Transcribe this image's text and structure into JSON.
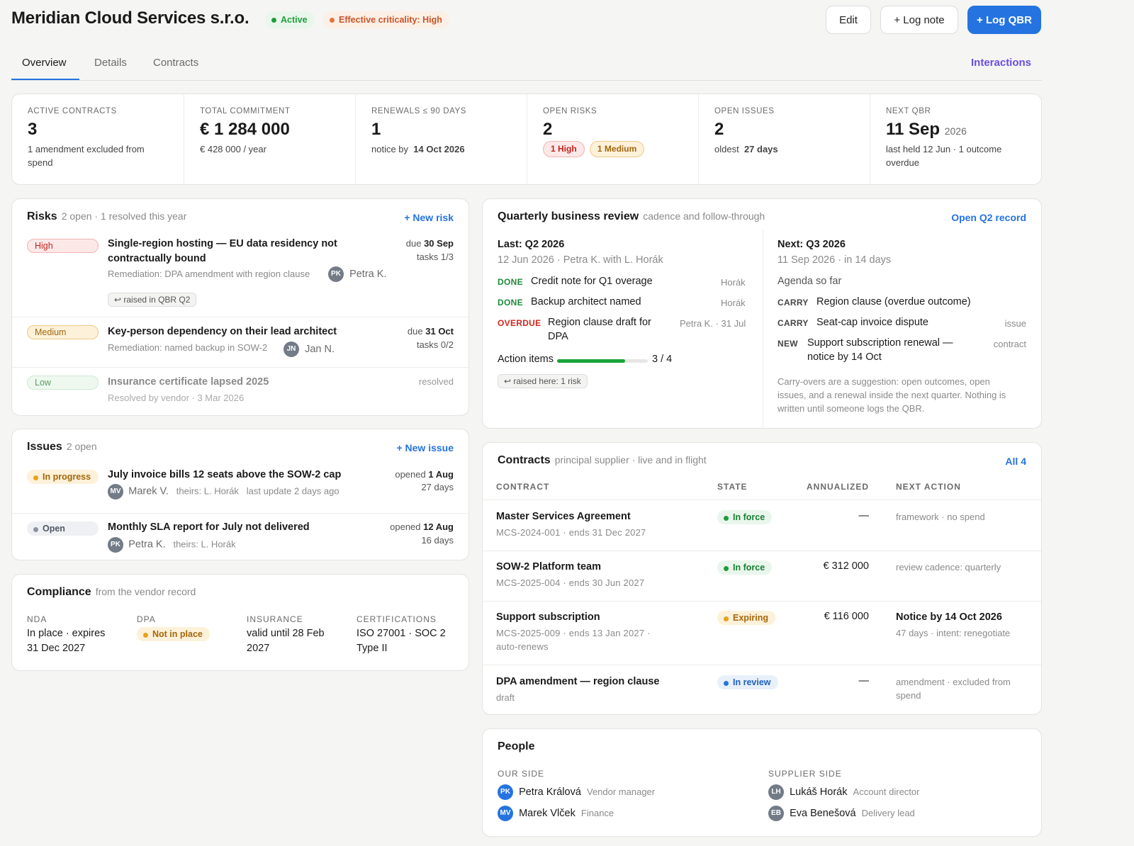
{
  "header": {
    "title": "Meridian Cloud Services s.r.o.",
    "status": "Active",
    "criticality": "Effective criticality: High",
    "edit": "Edit",
    "log_note": "+ Log note",
    "log_qbr": "+ Log QBR",
    "colors": {
      "active": "#1f9d3a",
      "criticality": "#e0763d",
      "primary": "#2573e0"
    }
  },
  "tabs": {
    "overview": "Overview",
    "details": "Details",
    "contracts": "Contracts",
    "interactions": "Interactions"
  },
  "kpis": [
    {
      "label": "ACTIVE CONTRACTS",
      "value": "3",
      "sub": "1 amendment excluded from spend"
    },
    {
      "label": "TOTAL COMMITMENT",
      "value": "€ 1 284 000",
      "sub": "€ 428 000 / year"
    },
    {
      "label": "RENEWALS ≤ 90 DAYS",
      "value": "1",
      "sub_prefix": "notice by",
      "sub_bold": "14 Oct 2026"
    },
    {
      "label": "OPEN RISKS",
      "value": "2",
      "pill_high": "1 High",
      "pill_med": "1 Medium"
    },
    {
      "label": "OPEN ISSUES",
      "value": "2",
      "sub_prefix": "oldest",
      "sub_bold": "27 days"
    },
    {
      "label": "NEXT QBR",
      "value": "11 Sep",
      "value_small": "2026",
      "sub": "last held 12 Jun · 1 outcome overdue"
    }
  ],
  "risks": {
    "title": "Risks",
    "subtitle": "2 open · 1 resolved this year",
    "new": "+ New risk",
    "items": [
      {
        "level": "High",
        "title_l1": "Single-region hosting — EU data residency not",
        "title_l2": "contractually bound",
        "remediation": "Remediation: DPA amendment with region clause",
        "owner_initials": "PK",
        "owner": "Petra K.",
        "due_prefix": "due",
        "due": "30 Sep",
        "tasks": "tasks 1/3",
        "chip": "↩ raised in QBR Q2"
      },
      {
        "level": "Medium",
        "title": "Key-person dependency on their lead architect",
        "remediation": "Remediation: named backup in SOW-2",
        "owner_initials": "JN",
        "owner": "Jan N.",
        "due_prefix": "due",
        "due": "31 Oct",
        "tasks": "tasks 0/2"
      },
      {
        "level": "Low",
        "title": "Insurance certificate lapsed 2025",
        "remediation": "Resolved by vendor · 3 Mar 2026",
        "status": "resolved"
      }
    ]
  },
  "issues": {
    "title": "Issues",
    "subtitle": "2 open",
    "new": "+ New issue",
    "items": [
      {
        "status": "In progress",
        "title": "July invoice bills 12 seats above the SOW-2 cap",
        "owner_initials": "MV",
        "owner": "Marek V.",
        "theirs": "theirs: L. Horák",
        "update": "last update 2 days ago",
        "opened_prefix": "opened",
        "opened": "1 Aug",
        "age": "27 days"
      },
      {
        "status": "Open",
        "title": "Monthly SLA report for July not delivered",
        "owner_initials": "PK",
        "owner": "Petra K.",
        "theirs": "theirs: L. Horák",
        "opened_prefix": "opened",
        "opened": "12 Aug",
        "age": "16 days"
      }
    ]
  },
  "compliance": {
    "title": "Compliance",
    "subtitle": "from the vendor record",
    "nda_label": "NDA",
    "nda_l1": "In place · expires",
    "nda_l2": "31 Dec 2027",
    "dpa_label": "DPA",
    "dpa_value": "Not in place",
    "ins_label": "INSURANCE",
    "ins_l1": "valid until 28 Feb",
    "ins_l2": "2027",
    "cert_label": "CERTIFICATIONS",
    "cert_l1": "ISO 27001 · SOC 2",
    "cert_l2": "Type II"
  },
  "qbr": {
    "title": "Quarterly business review",
    "subtitle": "cadence and follow-through",
    "link": "Open Q2 record",
    "last_title": "Last: Q2 2026",
    "last_meta": "12 Jun 2026 · Petra K. with L. Horák",
    "last_items": [
      {
        "tag": "DONE",
        "text": "Credit note for Q1 overage",
        "who": "Horák"
      },
      {
        "tag": "DONE",
        "text": "Backup architect named",
        "who": "Horák"
      },
      {
        "tag": "OVERDUE",
        "text_l1": "Region clause draft for",
        "text_l2": "DPA",
        "who": "Petra K. · 31 Jul"
      }
    ],
    "action_label": "Action items",
    "action_count": "3 / 4",
    "action_progress": 0.75,
    "chip": "↩ raised here: 1 risk",
    "next_title": "Next: Q3 2026",
    "next_meta": "11 Sep 2026 · in 14 days",
    "agenda": "Agenda so far",
    "next_items": [
      {
        "tag": "CARRY",
        "text": "Region clause (overdue outcome)",
        "kind": ""
      },
      {
        "tag": "CARRY",
        "text": "Seat-cap invoice dispute",
        "kind": "issue"
      },
      {
        "tag": "NEW",
        "text_l1": "Support subscription renewal —",
        "text_l2": "notice by 14 Oct",
        "kind": "contract"
      }
    ],
    "note_l1": "Carry-overs are a suggestion: open outcomes, open",
    "note_l2": "issues, and a renewal inside the next quarter. Nothing is",
    "note_l3": "written until someone logs the QBR."
  },
  "contracts": {
    "title": "Contracts",
    "subtitle": "principal supplier · live and in flight",
    "link": "All 4",
    "cols": [
      "CONTRACT",
      "STATE",
      "ANNUALIZED",
      "NEXT ACTION"
    ],
    "rows": [
      {
        "name": "Master Services Agreement",
        "meta": "MCS-2024-001 · ends 31 Dec 2027",
        "state": "In force",
        "amount": "—",
        "next": "framework · no spend"
      },
      {
        "name": "SOW-2 Platform team",
        "meta": "MCS-2025-004 · ends 30 Jun 2027",
        "state": "In force",
        "amount": "€ 312 000",
        "next": "review cadence: quarterly"
      },
      {
        "name": "Support subscription",
        "meta_l1": "MCS-2025-009 · ends 13 Jan 2027 ·",
        "meta_l2": "auto-renews",
        "state": "Expiring",
        "amount": "€ 116 000",
        "next_bold": "Notice by 14 Oct 2026",
        "next": "47 days · intent: renegotiate"
      },
      {
        "name": "DPA amendment — region clause",
        "meta": "draft",
        "state": "In review",
        "amount": "—",
        "next_l1": "amendment · excluded from",
        "next_l2": "spend"
      }
    ]
  },
  "people": {
    "title": "People",
    "ours_label": "OUR SIDE",
    "theirs_label": "SUPPLIER SIDE",
    "ours": [
      {
        "initials": "PK",
        "name": "Petra Králová",
        "role": "Vendor manager"
      },
      {
        "initials": "MV",
        "name": "Marek Vlček",
        "role": "Finance"
      }
    ],
    "theirs": [
      {
        "initials": "LH",
        "name": "Lukáš Horák",
        "role": "Account director"
      },
      {
        "initials": "EB",
        "name": "Eva Benešová",
        "role": "Delivery lead"
      }
    ]
  }
}
